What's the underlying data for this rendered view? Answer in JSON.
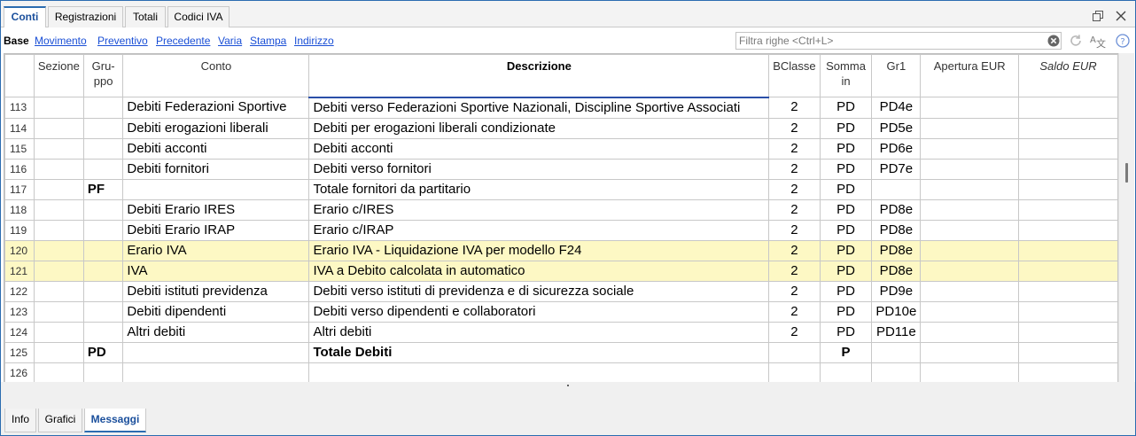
{
  "top_tabs": [
    "Conti",
    "Registrazioni",
    "Totali",
    "Codici IVA"
  ],
  "view_links": [
    "Base",
    "Movimento",
    "Preventivo",
    "Precedente",
    "Varia",
    "Stampa",
    "Indirizzo"
  ],
  "filter": {
    "placeholder": "Filtra righe <Ctrl+L>"
  },
  "table": {
    "headers": {
      "sezione": "Sezione",
      "gruppo": "Gru-ppo",
      "conto": "Conto",
      "descrizione": "Descrizione",
      "bclasse": "BClasse",
      "somma_in": "Somma in",
      "gr1": "Gr1",
      "apertura": "Apertura EUR",
      "saldo": "Saldo EUR"
    },
    "rows": [
      {
        "n": "113",
        "sezione": "",
        "gruppo": "",
        "conto": "Debiti Federazioni Sportive",
        "descrizione": "Debiti verso Federazioni Sportive Nazionali, Discipline Sportive Associati",
        "bclasse": "2",
        "somma_in": "PD",
        "gr1": "PD4e",
        "apertura": "",
        "saldo": "",
        "highlight": false,
        "bold": false
      },
      {
        "n": "114",
        "sezione": "",
        "gruppo": "",
        "conto": "Debiti erogazioni liberali",
        "descrizione": "Debiti per erogazioni liberali condizionate",
        "bclasse": "2",
        "somma_in": "PD",
        "gr1": "PD5e",
        "apertura": "",
        "saldo": "",
        "highlight": false,
        "bold": false
      },
      {
        "n": "115",
        "sezione": "",
        "gruppo": "",
        "conto": "Debiti acconti",
        "descrizione": "Debiti acconti",
        "bclasse": "2",
        "somma_in": "PD",
        "gr1": "PD6e",
        "apertura": "",
        "saldo": "",
        "highlight": false,
        "bold": false
      },
      {
        "n": "116",
        "sezione": "",
        "gruppo": "",
        "conto": "Debiti fornitori",
        "descrizione": "Debiti verso fornitori",
        "bclasse": "2",
        "somma_in": "PD",
        "gr1": "PD7e",
        "apertura": "",
        "saldo": "",
        "highlight": false,
        "bold": false
      },
      {
        "n": "117",
        "sezione": "",
        "gruppo": "PF",
        "conto": "",
        "descrizione": "Totale fornitori da partitario",
        "bclasse": "2",
        "somma_in": "PD",
        "gr1": "",
        "apertura": "",
        "saldo": "",
        "highlight": false,
        "bold": false
      },
      {
        "n": "118",
        "sezione": "",
        "gruppo": "",
        "conto": "Debiti Erario IRES",
        "descrizione": "Erario c/IRES",
        "bclasse": "2",
        "somma_in": "PD",
        "gr1": "PD8e",
        "apertura": "",
        "saldo": "",
        "highlight": false,
        "bold": false
      },
      {
        "n": "119",
        "sezione": "",
        "gruppo": "",
        "conto": "Debiti Erario IRAP",
        "descrizione": "Erario c/IRAP",
        "bclasse": "2",
        "somma_in": "PD",
        "gr1": "PD8e",
        "apertura": "",
        "saldo": "",
        "highlight": false,
        "bold": false
      },
      {
        "n": "120",
        "sezione": "",
        "gruppo": "",
        "conto": "Erario IVA",
        "descrizione": "Erario IVA - Liquidazione IVA per modello F24",
        "bclasse": "2",
        "somma_in": "PD",
        "gr1": "PD8e",
        "apertura": "",
        "saldo": "",
        "highlight": true,
        "bold": false
      },
      {
        "n": "121",
        "sezione": "",
        "gruppo": "",
        "conto": "IVA",
        "descrizione": "IVA a Debito calcolata in automatico",
        "bclasse": "2",
        "somma_in": "PD",
        "gr1": "PD8e",
        "apertura": "",
        "saldo": "",
        "highlight": true,
        "bold": false
      },
      {
        "n": "122",
        "sezione": "",
        "gruppo": "",
        "conto": "Debiti istituti previdenza",
        "descrizione": "Debiti verso istituti di previdenza e di sicurezza sociale",
        "bclasse": "2",
        "somma_in": "PD",
        "gr1": "PD9e",
        "apertura": "",
        "saldo": "",
        "highlight": false,
        "bold": false
      },
      {
        "n": "123",
        "sezione": "",
        "gruppo": "",
        "conto": "Debiti dipendenti",
        "descrizione": "Debiti verso dipendenti e collaboratori",
        "bclasse": "2",
        "somma_in": "PD",
        "gr1": "PD10e",
        "apertura": "",
        "saldo": "",
        "highlight": false,
        "bold": false
      },
      {
        "n": "124",
        "sezione": "",
        "gruppo": "",
        "conto": "Altri debiti",
        "descrizione": "Altri debiti",
        "bclasse": "2",
        "somma_in": "PD",
        "gr1": "PD11e",
        "apertura": "",
        "saldo": "",
        "highlight": false,
        "bold": false
      },
      {
        "n": "125",
        "sezione": "",
        "gruppo": "PD",
        "conto": "",
        "descrizione": "Totale Debiti",
        "bclasse": "",
        "somma_in": "P",
        "gr1": "",
        "apertura": "",
        "saldo": "",
        "highlight": false,
        "bold": true
      },
      {
        "n": "126",
        "sezione": "",
        "gruppo": "",
        "conto": "",
        "descrizione": "",
        "bclasse": "",
        "somma_in": "",
        "gr1": "",
        "apertura": "",
        "saldo": "",
        "highlight": false,
        "bold": false
      }
    ]
  },
  "bottom_tabs": [
    "Info",
    "Grafici",
    "Messaggi"
  ],
  "colors": {
    "accent": "#2b6cb0",
    "link": "#1a4fd6",
    "highlight_row": "#fdf8c4"
  }
}
